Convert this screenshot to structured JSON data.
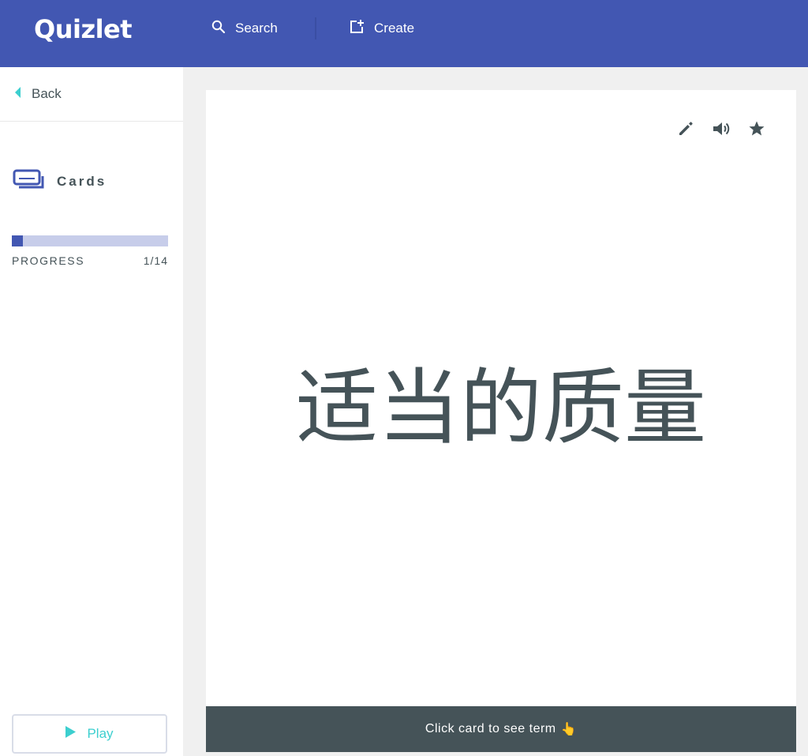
{
  "header": {
    "logo": "Quizlet",
    "search_label": "Search",
    "create_label": "Create"
  },
  "sidebar": {
    "back_label": "Back",
    "mode_label": "Cards",
    "progress": {
      "label": "PROGRESS",
      "count": "1/14",
      "current": 1,
      "total": 14
    },
    "play_label": "Play"
  },
  "card": {
    "term": "适当的质量",
    "footer_text": "Click card to see term",
    "footer_emoji": "👆"
  },
  "colors": {
    "brand": "#4257b2",
    "accent": "#3ccfcf",
    "text": "#455358"
  },
  "icons": [
    "search-icon",
    "create-icon",
    "back-arrow-icon",
    "cards-icon",
    "play-icon",
    "edit-icon",
    "audio-icon",
    "star-icon"
  ]
}
